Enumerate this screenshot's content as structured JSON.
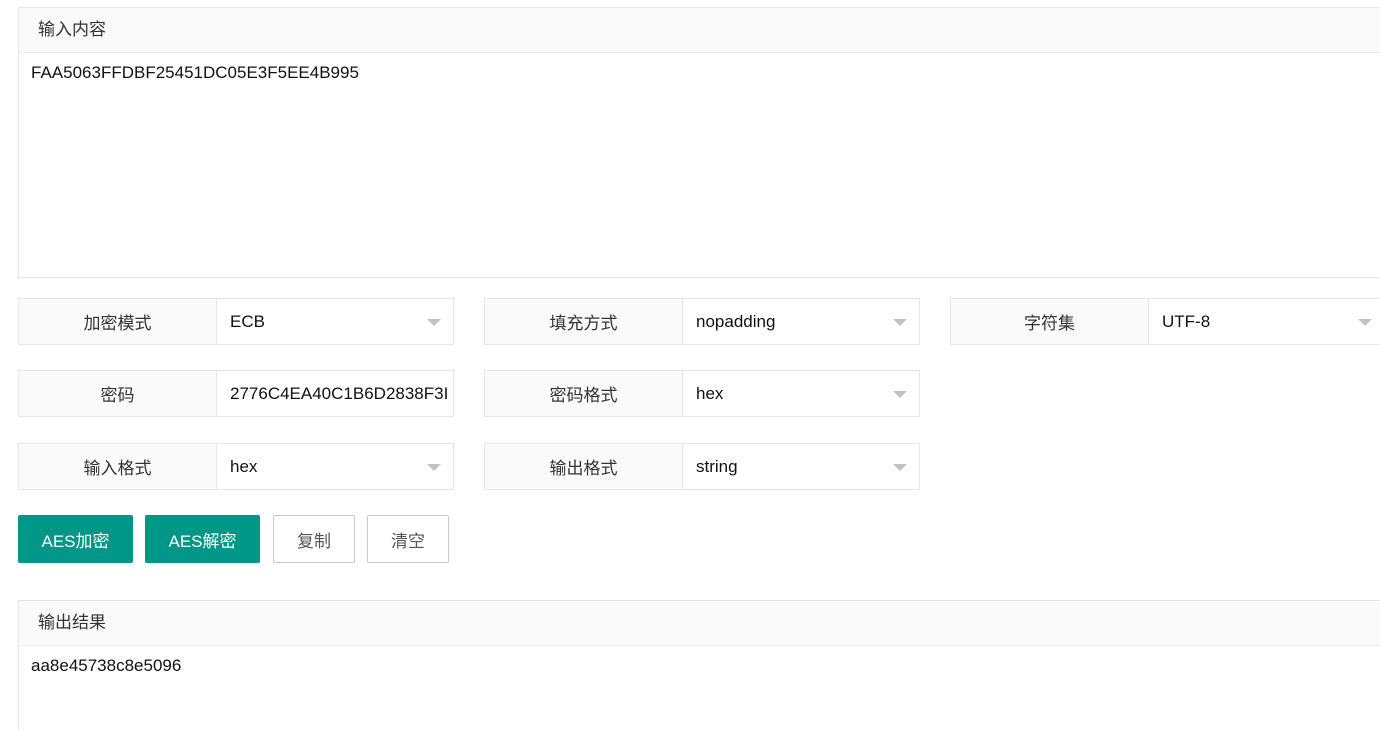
{
  "input_panel": {
    "title": "输入内容",
    "value": "FAA5063FFDBF25451DC05E3F5EE4B995"
  },
  "fields": {
    "encrypt_mode": {
      "label": "加密模式",
      "value": "ECB"
    },
    "padding": {
      "label": "填充方式",
      "value": "nopadding"
    },
    "charset": {
      "label": "字符集",
      "value": "UTF-8"
    },
    "password": {
      "label": "密码",
      "value": "2776C4EA40C1B6D2838F3I"
    },
    "password_format": {
      "label": "密码格式",
      "value": "hex"
    },
    "input_format": {
      "label": "输入格式",
      "value": "hex"
    },
    "output_format": {
      "label": "输出格式",
      "value": "string"
    }
  },
  "buttons": {
    "encrypt": "AES加密",
    "decrypt": "AES解密",
    "copy": "复制",
    "clear": "清空"
  },
  "output_panel": {
    "title": "输出结果",
    "value": "aa8e45738c8e5096"
  },
  "colors": {
    "primary": "#009688",
    "border": "#e6e6e6",
    "label_bg": "#fafafa"
  }
}
